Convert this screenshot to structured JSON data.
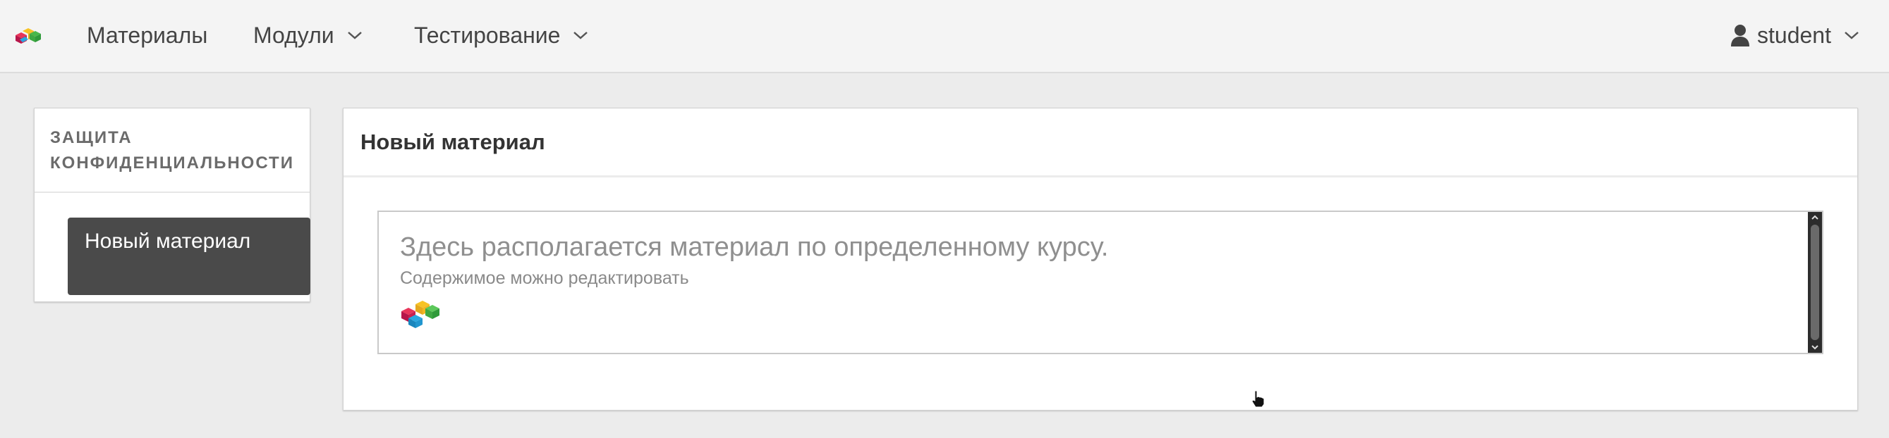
{
  "navbar": {
    "brand_icon": "brand-cubes-icon",
    "items": [
      {
        "label": "Материалы",
        "has_dropdown": false
      },
      {
        "label": "Модули",
        "has_dropdown": true
      },
      {
        "label": "Тестирование",
        "has_dropdown": true
      }
    ],
    "user": {
      "label": "student",
      "icon": "user-icon",
      "has_dropdown": true
    }
  },
  "sidebar": {
    "title": "ЗАЩИТА КОНФИДЕНЦИАЛЬНОСТИ",
    "active_item": "Новый материал"
  },
  "main": {
    "title": "Новый материал",
    "editor": {
      "headline": "Здесь располагается материал по определенному курсу.",
      "subtext": "Содержимое можно редактировать",
      "logo_icon": "brand-cubes-icon"
    }
  },
  "colors": {
    "navbar_bg": "#f4f4f4",
    "page_bg": "#ececec",
    "active_item_bg": "#4a4a4a",
    "text": "#333333",
    "muted_text": "#8f8f8f"
  }
}
